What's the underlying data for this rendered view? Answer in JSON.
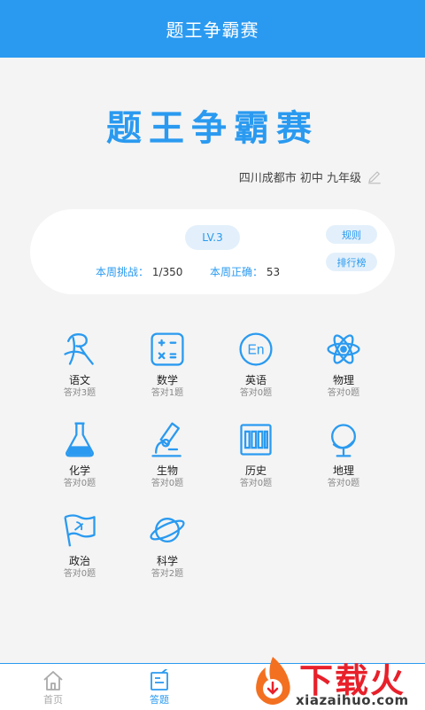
{
  "header": {
    "title": "题王争霸赛"
  },
  "hero": {
    "title": "题王争霸赛"
  },
  "location": "四川成都市 初中 九年级",
  "card": {
    "level": "LV.3",
    "weekly_challenge_label": "本周挑战：",
    "weekly_challenge_value": "1/350",
    "weekly_correct_label": "本周正确：",
    "weekly_correct_value": "53",
    "rules_label": "规则",
    "ranking_label": "排行榜"
  },
  "subjects": [
    {
      "name": "语文",
      "count": "答对3题",
      "icon": "chinese-icon"
    },
    {
      "name": "数学",
      "count": "答对1题",
      "icon": "math-icon"
    },
    {
      "name": "英语",
      "count": "答对0题",
      "icon": "english-icon"
    },
    {
      "name": "物理",
      "count": "答对0题",
      "icon": "physics-icon"
    },
    {
      "name": "化学",
      "count": "答对0题",
      "icon": "chemistry-icon"
    },
    {
      "name": "生物",
      "count": "答对0题",
      "icon": "biology-icon"
    },
    {
      "name": "历史",
      "count": "答对0题",
      "icon": "history-icon"
    },
    {
      "name": "地理",
      "count": "答对0题",
      "icon": "geography-icon"
    },
    {
      "name": "政治",
      "count": "答对0题",
      "icon": "politics-icon"
    },
    {
      "name": "科学",
      "count": "答对2题",
      "icon": "science-icon"
    }
  ],
  "tabs": {
    "home_label": "首页",
    "answer_label": "答题"
  },
  "watermark": {
    "text": "下载火",
    "url": "xiazaihuo.com"
  },
  "colors": {
    "accent": "#2a9af0",
    "background": "#f4f4f4",
    "watermark_red": "#e8202a"
  }
}
